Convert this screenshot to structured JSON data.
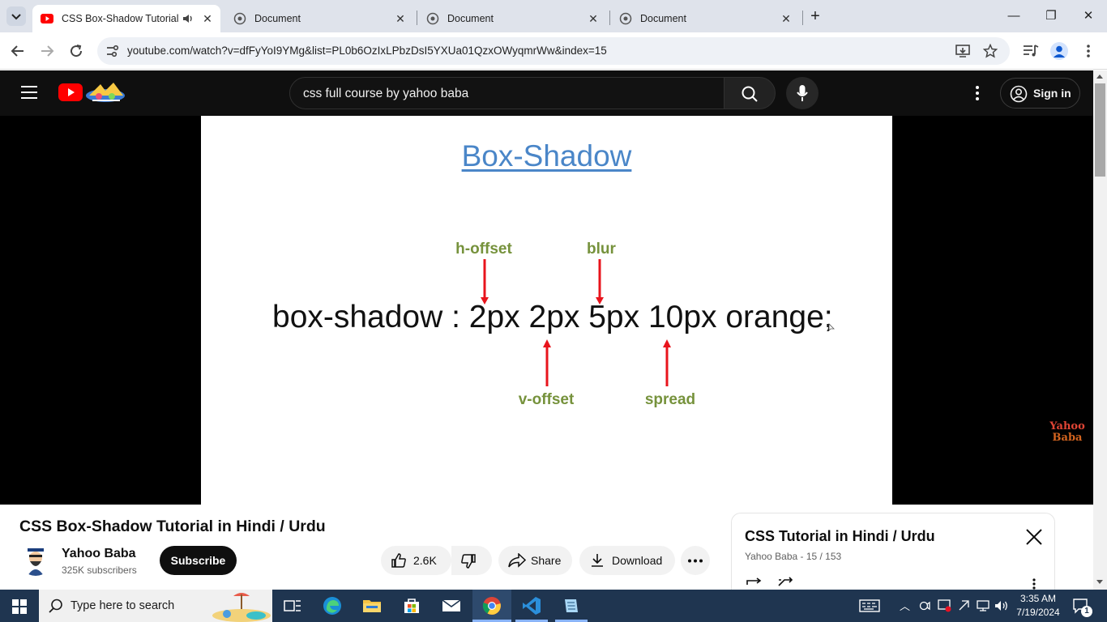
{
  "browser": {
    "tabs": [
      {
        "title": "CSS Box-Shadow Tutorial in",
        "active": true,
        "favicon": "youtube-icon",
        "audio": true
      },
      {
        "title": "Document",
        "active": false,
        "favicon": "globe-icon"
      },
      {
        "title": "Document",
        "active": false,
        "favicon": "globe-icon"
      },
      {
        "title": "Document",
        "active": false,
        "favicon": "globe-icon"
      }
    ],
    "url": "youtube.com/watch?v=dfFyYoI9YMg&list=PL0b6OzIxLPbzDsI5YXUa01QzxOWyqmrWw&index=15"
  },
  "youtube": {
    "search_query": "css full course by yahoo baba",
    "signin_label": "Sign in",
    "slide": {
      "title": "Box-Shadow",
      "code": "box-shadow : 2px 2px 5px 10px orange;",
      "labels": {
        "h_offset": "h-offset",
        "blur": "blur",
        "v_offset": "v-offset",
        "spread": "spread"
      },
      "watermark_line1": "Yahoo",
      "watermark_line2": "Baba"
    },
    "video_title": "CSS Box-Shadow Tutorial in Hindi / Urdu",
    "channel_name": "Yahoo Baba",
    "subscribers": "325K subscribers",
    "subscribe_label": "Subscribe",
    "likes": "2.6K",
    "share_label": "Share",
    "download_label": "Download",
    "playlist": {
      "title": "CSS Tutorial in Hindi / Urdu",
      "meta": "Yahoo Baba - 15 / 153"
    }
  },
  "taskbar": {
    "search_placeholder": "Type here to search",
    "time": "3:35 AM",
    "date": "7/19/2024",
    "notification_count": "1"
  },
  "colors": {
    "yt_red": "#ff0000",
    "label_green": "#76923c",
    "arrow_red": "#e8141c",
    "title_blue": "#4a86c8"
  }
}
